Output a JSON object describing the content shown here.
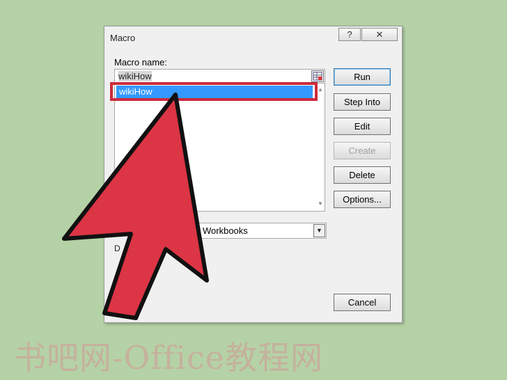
{
  "dialog": {
    "title": "Macro",
    "help_label": "?",
    "close_label": "✕",
    "macro_name_label": "Macro name:",
    "macro_name_value": "wikiHow",
    "macro_list": [
      "wikiHow"
    ],
    "macros_in_value": "Workbooks",
    "description_label": "D",
    "buttons": {
      "run": "Run",
      "step_into": "Step Into",
      "edit": "Edit",
      "create": "Create",
      "delete": "Delete",
      "options": "Options...",
      "cancel": "Cancel"
    }
  },
  "annotation": {
    "highlight_color": "#cc2b3c",
    "arrow_color": "#dc3545"
  },
  "watermark": "书吧网-Office教程网"
}
